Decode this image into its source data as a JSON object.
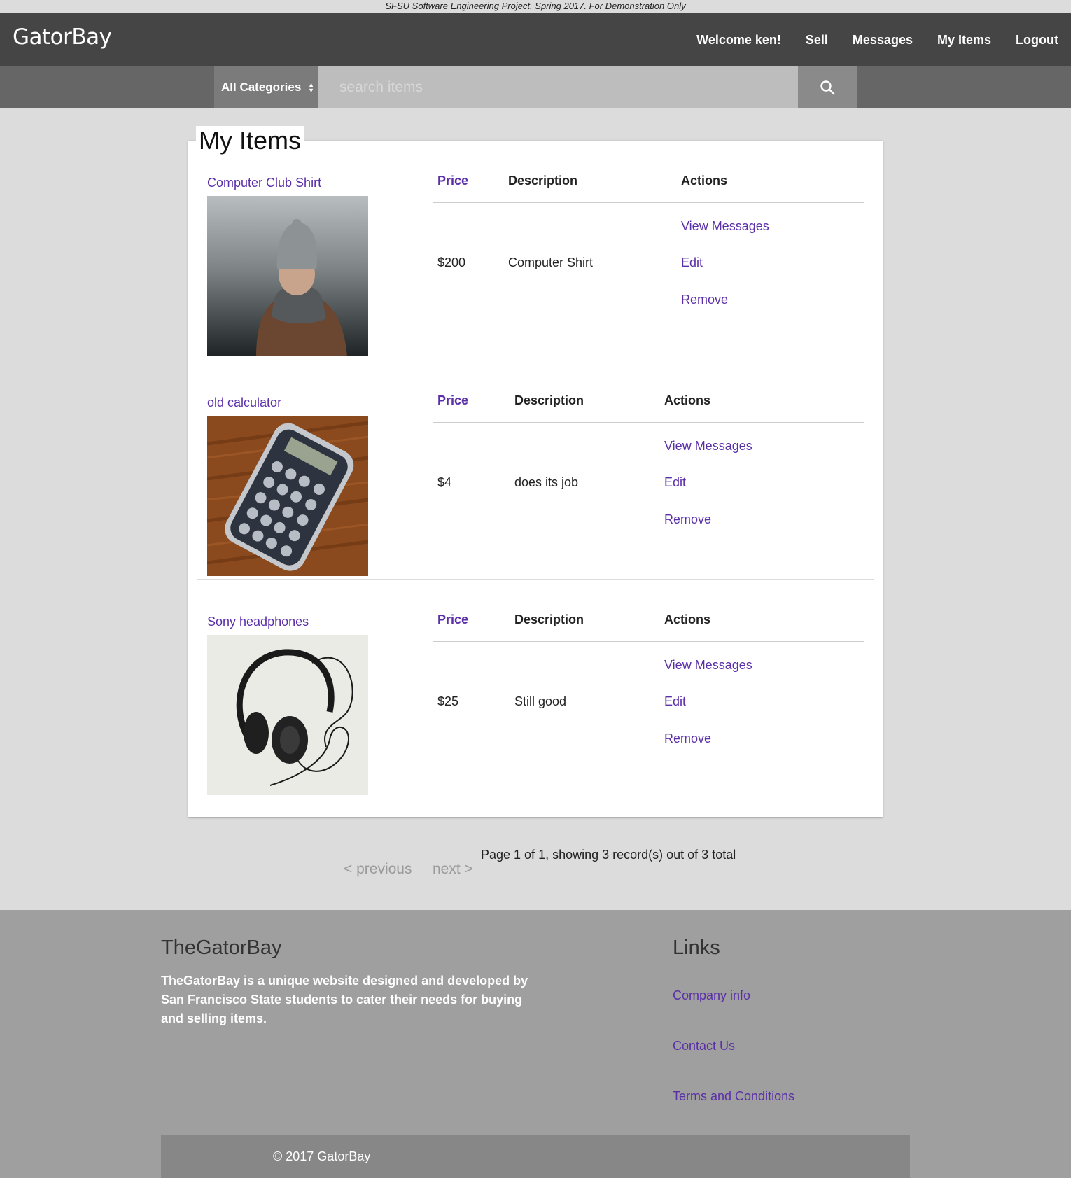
{
  "banner": {
    "text": "SFSU Software Engineering Project, Spring 2017. For Demonstration Only"
  },
  "navbar": {
    "brand": "GatorBay",
    "links": [
      {
        "label": "Welcome ken!"
      },
      {
        "label": "Sell"
      },
      {
        "label": "Messages"
      },
      {
        "label": "My Items"
      },
      {
        "label": "Logout"
      }
    ]
  },
  "search": {
    "category": "All Categories",
    "placeholder": "search items",
    "icon": "search-icon"
  },
  "main": {
    "title": "My Items",
    "headers": {
      "price": "Price",
      "description": "Description",
      "actions": "Actions"
    },
    "action_labels": {
      "view": "View Messages",
      "edit": "Edit",
      "remove": "Remove"
    },
    "items": [
      {
        "name": "Computer Club Shirt",
        "price": "$200",
        "description": "Computer Shirt"
      },
      {
        "name": "old calculator",
        "price": "$4",
        "description": "does its job"
      },
      {
        "name": "Sony headphones",
        "price": "$25",
        "description": "Still good"
      }
    ]
  },
  "pagination": {
    "info": "Page 1 of 1, showing 3 record(s) out of 3 total",
    "previous": "< previous",
    "next": "next >"
  },
  "footer": {
    "title": "TheGatorBay",
    "text": "TheGatorBay is a unique website designed and developed by San Francisco State students to cater their needs for buying and selling items.",
    "links_title": "Links",
    "links": [
      {
        "label": "Company info"
      },
      {
        "label": "Contact Us"
      },
      {
        "label": "Terms and Conditions"
      }
    ],
    "copyright": "© 2017 GatorBay"
  },
  "colors": {
    "accent": "#5a2fa8",
    "navbar": "#454545",
    "footer": "#9f9f9f"
  }
}
